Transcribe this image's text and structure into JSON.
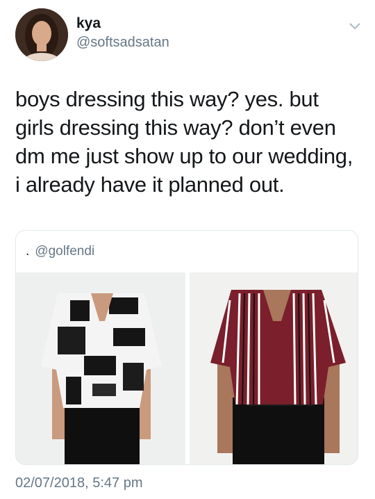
{
  "tweet": {
    "display_name": "kya",
    "handle": "@softsadsatan",
    "text": "boys dressing this way? yes. but girls dressing this way? don’t even dm me just show up to our wedding, i already have it planned out.",
    "timestamp": "02/07/2018, 5:47 pm",
    "menu_icon": "chevron-down-icon"
  },
  "quoted": {
    "prefix": ".",
    "handle": "@golfendi",
    "photos": [
      {
        "description_icon": "photo-abstract-print-shirt"
      },
      {
        "description_icon": "photo-striped-shirt"
      }
    ]
  },
  "colors": {
    "text": "#14171a",
    "secondary": "#657786",
    "border": "#e1e8ed",
    "stripe_red": "#7a1f2b"
  }
}
